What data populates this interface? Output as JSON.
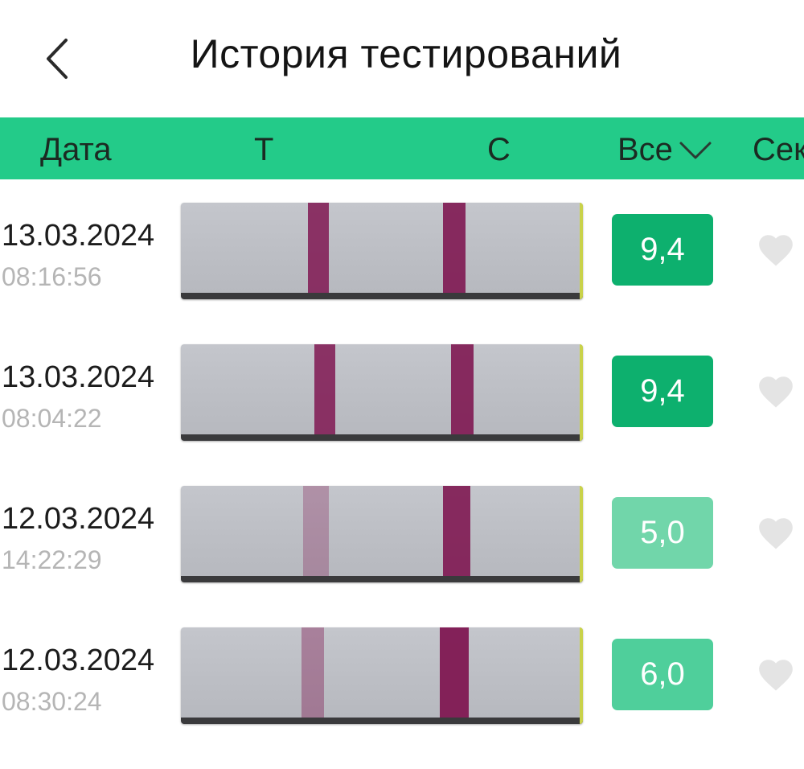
{
  "header": {
    "title": "История тестирований",
    "back_icon": "chevron-left-icon"
  },
  "columns": {
    "date": "Дата",
    "t": "Т",
    "c": "С",
    "filter": "Все",
    "filter_icon": "chevron-down-icon",
    "extra": "Сек"
  },
  "colors": {
    "header_bar": "#23cb89",
    "score_high": "#0db06e",
    "score_mid": "#4fcf9b",
    "score_low": "#71d6aa",
    "heart": "#e4e4e4"
  },
  "rows": [
    {
      "date": "13.03.2024",
      "time": "08:16:56",
      "score": "9,4",
      "favorite": false,
      "t_line_intensity": 0.85,
      "c_line_intensity": 0.9
    },
    {
      "date": "13.03.2024",
      "time": "08:04:22",
      "score": "9,4",
      "favorite": false,
      "t_line_intensity": 0.85,
      "c_line_intensity": 0.9
    },
    {
      "date": "12.03.2024",
      "time": "14:22:29",
      "score": "5,0",
      "favorite": false,
      "t_line_intensity": 0.3,
      "c_line_intensity": 0.9
    },
    {
      "date": "12.03.2024",
      "time": "08:30:24",
      "score": "6,0",
      "favorite": false,
      "t_line_intensity": 0.4,
      "c_line_intensity": 0.95
    }
  ]
}
